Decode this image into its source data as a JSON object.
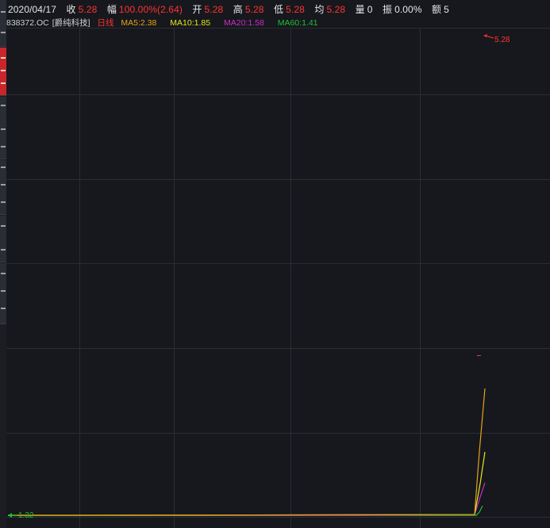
{
  "header": {
    "date": "2020/04/17",
    "close_label": "收",
    "close_value": "5.28",
    "change_label": "幅",
    "change_value": "100.00%(2.64)",
    "open_label": "开",
    "open_value": "5.28",
    "high_label": "高",
    "high_value": "5.28",
    "low_label": "低",
    "low_value": "5.28",
    "avg_label": "均",
    "avg_value": "5.28",
    "volume_label": "量",
    "volume_value": "0",
    "amplitude_label": "振",
    "amplitude_value": "0.00%",
    "amount_label": "额",
    "amount_value": "5"
  },
  "legend": {
    "code": "838372.OC",
    "name": "[爵纯科技]",
    "period": "日线",
    "ma5": "MA5:2.38",
    "ma10": "MA10:1.85",
    "ma20": "MA20:1.58",
    "ma60": "MA60:1.41"
  },
  "colors": {
    "background": "#16181d",
    "grid": "#2a2d33",
    "up": "#ff3232",
    "ma5": "#e8a317",
    "ma10": "#e6e61c",
    "ma20": "#cc2bcc",
    "ma60": "#1fbf3a"
  },
  "chart_data": {
    "type": "line",
    "title": "838372.OC [爵纯科技] 日线",
    "price_range": [
      1.32,
      5.28
    ],
    "annotations": {
      "high_label": "5.28",
      "low_label": "1.32"
    },
    "last_bar": {
      "date": "2020/04/17",
      "open": 5.28,
      "high": 5.28,
      "low": 5.28,
      "close": 5.28
    },
    "series": [
      {
        "name": "MA5",
        "last": 2.38
      },
      {
        "name": "MA10",
        "last": 1.85
      },
      {
        "name": "MA20",
        "last": 1.58
      },
      {
        "name": "MA60",
        "last": 1.41
      }
    ]
  }
}
